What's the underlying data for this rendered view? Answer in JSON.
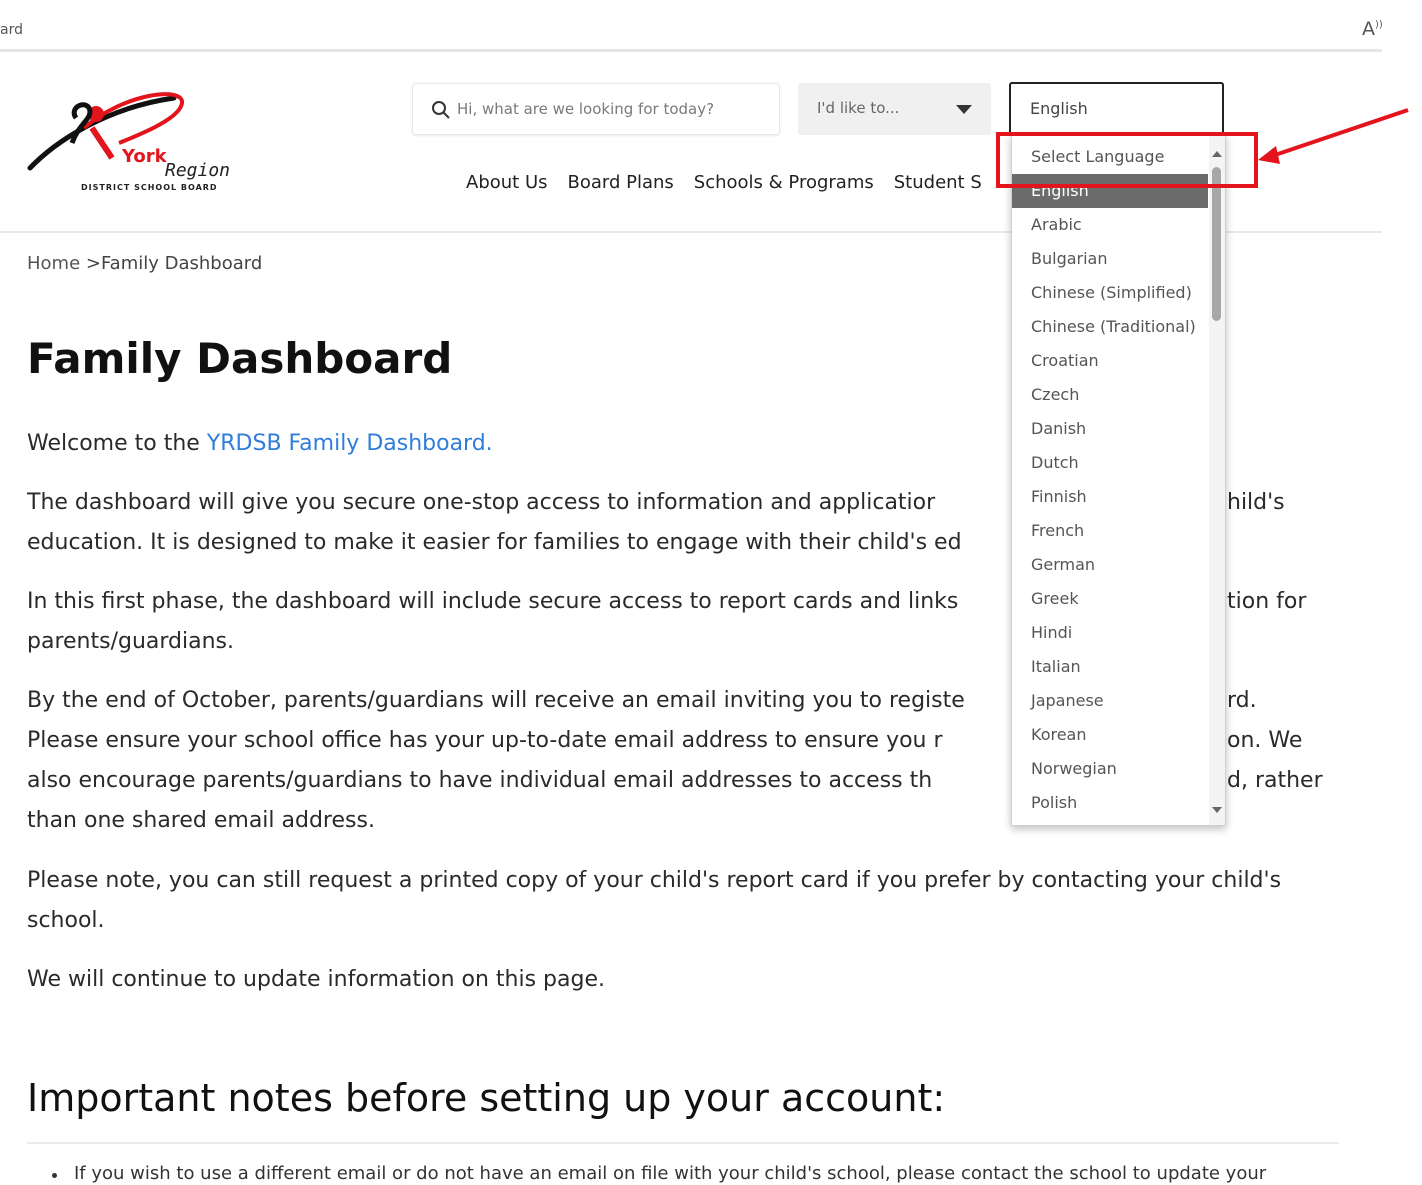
{
  "browser": {
    "address_fragment": "ard",
    "read_aloud_icon": "read-aloud-icon"
  },
  "header": {
    "logo": {
      "brand_top": "York",
      "brand_mid": "Region",
      "brand_sub": "DISTRICT SCHOOL BOARD"
    },
    "search": {
      "placeholder": "Hi, what are we looking for today?",
      "icon": "search-icon"
    },
    "id_like": {
      "label": "I'd like to..."
    },
    "language": {
      "selected": "English"
    },
    "nav": [
      "About Us",
      "Board Plans",
      "Schools & Programs",
      "Student S"
    ]
  },
  "breadcrumb": {
    "home": "Home",
    "separator": ">",
    "current": "Family Dashboard"
  },
  "page": {
    "title": "Family Dashboard",
    "welcome_prefix": "Welcome to the ",
    "welcome_link": "YRDSB Family Dashboard.",
    "p2a": "The dashboard will give you secure one-stop access to information and applicatior",
    "p2b": "hild's",
    "p2c": "education. It is designed to make it easier for families to engage with their child's ed",
    "p3a": "In this first phase, the dashboard will include secure access to report cards and links",
    "p3b": "tion for",
    "p3c": "parents/guardians.",
    "p4a": "By the end of October, parents/guardians will receive an email inviting you to registe",
    "p4b": "rd.",
    "p4c": "Please ensure your school office has your up-to-date email address to ensure you r",
    "p4d": "on. We",
    "p4e": "also encourage parents/guardians to have individual email addresses to access th",
    "p4f": "d, rather",
    "p4g": "than one shared email address.",
    "p5": "Please note, you can still request a printed copy of your child's report card if you prefer by contacting your child's school.",
    "p6": "We will continue to update information on this page.",
    "notes_heading": "Important notes before setting up your account:",
    "bullet1": "If you wish to use a different email or do not have an email on file with your child's school, please contact the school to update your"
  },
  "language_dropdown": {
    "options": [
      "Select Language",
      "English",
      "Arabic",
      "Bulgarian",
      "Chinese (Simplified)",
      "Chinese (Traditional)",
      "Croatian",
      "Czech",
      "Danish",
      "Dutch",
      "Finnish",
      "French",
      "German",
      "Greek",
      "Hindi",
      "Italian",
      "Japanese",
      "Korean",
      "Norwegian",
      "Polish"
    ],
    "selected_index": 1
  },
  "colors": {
    "annotation": "#e3141b",
    "link": "#2f7ddb",
    "logo_red": "#e3141b"
  }
}
